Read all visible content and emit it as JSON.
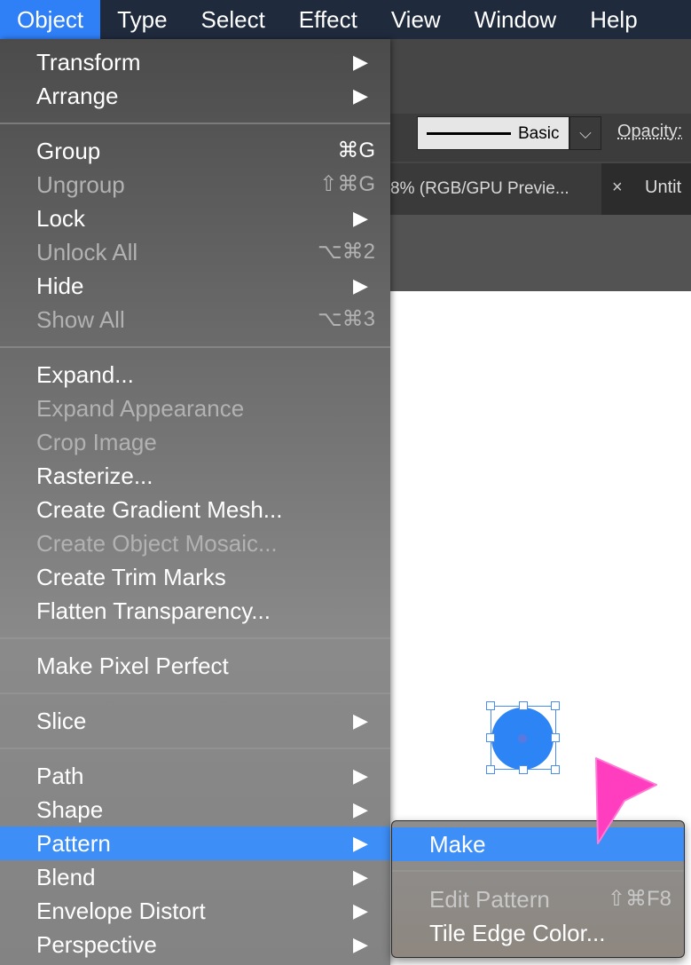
{
  "menubar": {
    "items": [
      "Object",
      "Type",
      "Select",
      "Effect",
      "View",
      "Window",
      "Help"
    ]
  },
  "controls": {
    "stroke_style": "Basic",
    "dropdown_caret": "⌵",
    "opacity_label": "Opacity:"
  },
  "tabs": {
    "active_tab": "8% (RGB/GPU Previe...",
    "close_glyph": "×",
    "other_tab": "Untit"
  },
  "object_menu": {
    "transform": "Transform",
    "arrange": "Arrange",
    "group": "Group",
    "group_shortcut": "⌘G",
    "ungroup": "Ungroup",
    "ungroup_shortcut": "⇧⌘G",
    "lock": "Lock",
    "unlock_all": "Unlock All",
    "unlock_all_shortcut": "⌥⌘2",
    "hide": "Hide",
    "show_all": "Show All",
    "show_all_shortcut": "⌥⌘3",
    "expand": "Expand...",
    "expand_appearance": "Expand Appearance",
    "crop_image": "Crop Image",
    "rasterize": "Rasterize...",
    "create_gradient_mesh": "Create Gradient Mesh...",
    "create_object_mosaic": "Create Object Mosaic...",
    "create_trim_marks": "Create Trim Marks",
    "flatten_transparency": "Flatten Transparency...",
    "make_pixel_perfect": "Make Pixel Perfect",
    "slice": "Slice",
    "path": "Path",
    "shape": "Shape",
    "pattern": "Pattern",
    "blend": "Blend",
    "envelope_distort": "Envelope Distort",
    "perspective": "Perspective",
    "submenu_arrow": "▶"
  },
  "pattern_submenu": {
    "make": "Make",
    "edit_pattern": "Edit Pattern",
    "edit_pattern_shortcut": "⇧⌘F8",
    "tile_edge_color": "Tile Edge Color..."
  },
  "colors": {
    "menubar_bg": "#1f2a3d",
    "highlight": "#3d8ef7",
    "selection_blue": "#2d84f5",
    "cursor_pink": "#ff3dbf"
  },
  "icons": {
    "cursor": "pink-arrow-cursor-icon",
    "submenu": "triangle-right-icon"
  }
}
